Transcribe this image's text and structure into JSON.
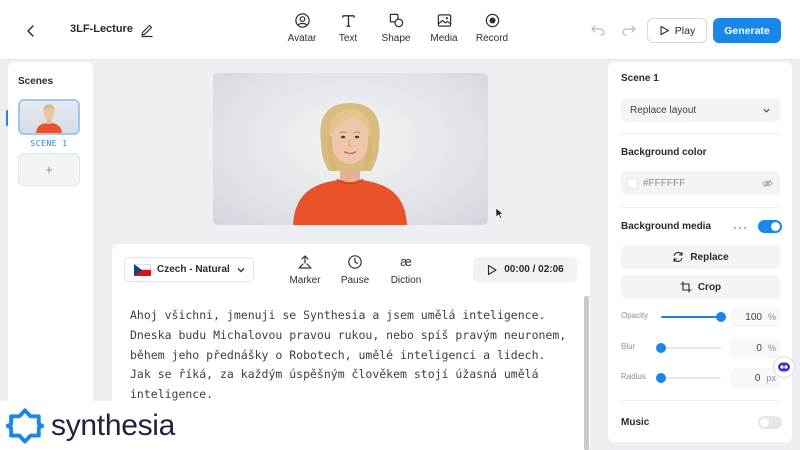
{
  "header": {
    "project_title": "3LF-Lecture",
    "tools": [
      {
        "label": "Avatar",
        "icon": "avatar-icon"
      },
      {
        "label": "Text",
        "icon": "text-icon"
      },
      {
        "label": "Shape",
        "icon": "shape-icon"
      },
      {
        "label": "Media",
        "icon": "media-icon"
      },
      {
        "label": "Record",
        "icon": "record-icon"
      }
    ],
    "play_label": "Play",
    "generate_label": "Generate"
  },
  "scenes": {
    "title": "Scenes",
    "items": [
      {
        "label": "SCENE 1"
      }
    ],
    "add_label": "+"
  },
  "script": {
    "language": "Czech - Natural",
    "tools": [
      {
        "label": "Marker",
        "icon": "marker-icon"
      },
      {
        "label": "Pause",
        "icon": "clock-icon"
      },
      {
        "label": "Diction",
        "icon": "diction-icon"
      }
    ],
    "diction_glyph": "æ",
    "time": "00:00 / 02:06",
    "text": "Ahoj všichni, jmenuji se Synthesia a jsem umělá inteligence. Dneska budu Michalovou pravou rukou, nebo spíš pravým neuronem, během jeho přednášky o Robotech, umělé inteligenci a lidech. Jak se říká, za každým úspěšným člověkem stojí úžasná umělá inteligence."
  },
  "properties": {
    "scene_title": "Scene 1",
    "layout_select": "Replace layout",
    "background_color_title": "Background color",
    "background_color_value": "#FFFFFF",
    "background_media_title": "Background media",
    "background_media_enabled": true,
    "more_label": "···",
    "replace_label": "Replace",
    "crop_label": "Crop",
    "sliders": [
      {
        "label": "Opacity",
        "value": "100",
        "unit": "%",
        "fraction": 1.0
      },
      {
        "label": "Blur",
        "value": "0",
        "unit": "%",
        "fraction": 0.0
      },
      {
        "label": "Radius",
        "value": "0",
        "unit": "px",
        "fraction": 0.0
      }
    ],
    "music_title": "Music",
    "music_enabled": false
  },
  "logo": {
    "text": "synthesia"
  },
  "colors": {
    "accent": "#1a87e8",
    "avatar_shirt": "#e8532a",
    "canvas_bg": "#dfe1e6"
  }
}
